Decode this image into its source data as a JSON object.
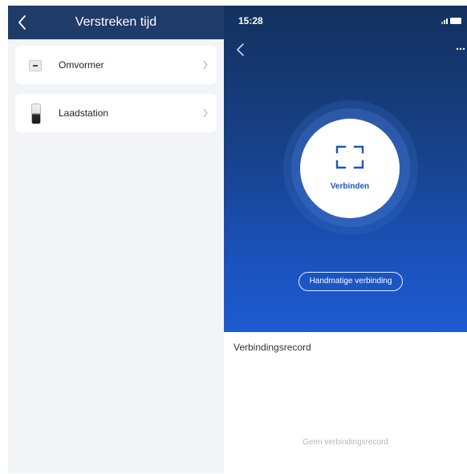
{
  "left_screen": {
    "header": {
      "title": "Verstreken tijd"
    },
    "items": [
      {
        "label": "Omvormer",
        "icon": "inverter-icon"
      },
      {
        "label": "Laadstation",
        "icon": "charging-station-icon"
      }
    ]
  },
  "right_screen": {
    "status_bar": {
      "time": "15:28"
    },
    "connect_button": {
      "label": "Verbinden",
      "icon": "scan-frame-icon"
    },
    "manual_button": {
      "label": "Handmatige verbinding"
    },
    "records": {
      "title": "Verbindingsrecord",
      "empty_text": "Geen verbindingsrecord"
    }
  },
  "colors": {
    "header_navy": "#1f3b6a",
    "hero_top": "#14305e",
    "hero_bottom": "#1d5bd0",
    "accent_blue": "#1b56c8",
    "page_gray": "#f3f4f8"
  }
}
